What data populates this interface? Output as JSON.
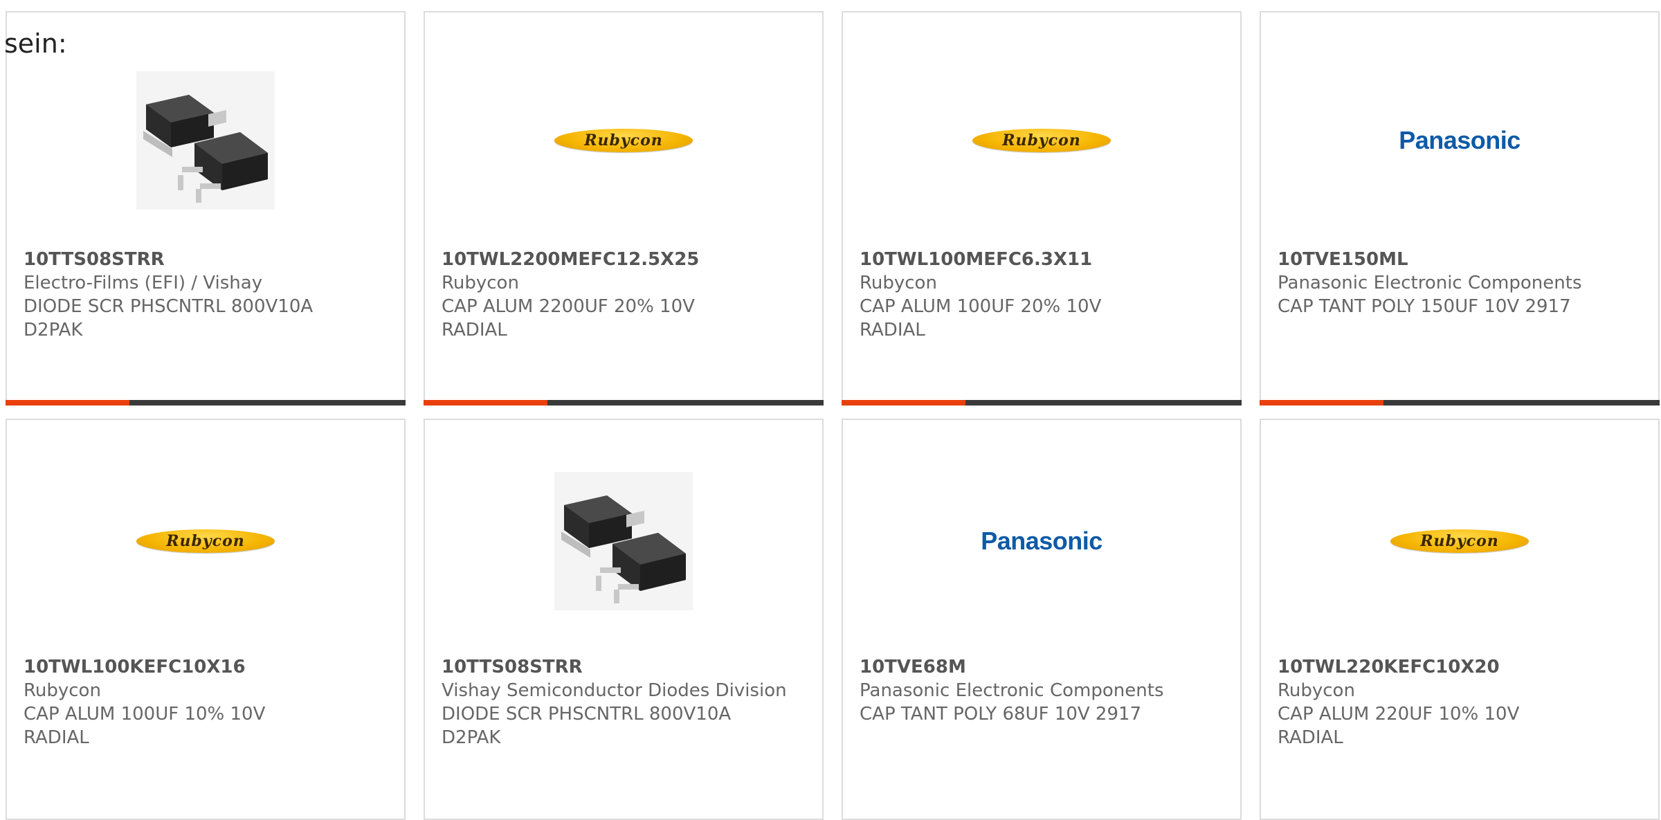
{
  "prefix_text": "sein:",
  "colors": {
    "accent_bar": "#e8400c",
    "dark_bar": "#3a3a3a",
    "rubycon_yellow": "#f5b400",
    "panasonic_blue": "#0e5aa7"
  },
  "logos": {
    "rubycon": "Rubycon",
    "panasonic": "Panasonic"
  },
  "cards": [
    {
      "part_number": "10TTS08STRR",
      "manufacturer": "Electro-Films (EFI) / Vishay",
      "description_lines": [
        "DIODE SCR PHSCNTRL 800V10A",
        "D2PAK"
      ],
      "image": "d2pak-package-icon",
      "progress_fraction": 0.31
    },
    {
      "part_number": "10TWL2200MEFC12.5X25",
      "manufacturer": "Rubycon",
      "description_lines": [
        "CAP ALUM 2200UF 20% 10V",
        "RADIAL"
      ],
      "image": "rubycon-logo",
      "progress_fraction": 0.31
    },
    {
      "part_number": "10TWL100MEFC6.3X11",
      "manufacturer": "Rubycon",
      "description_lines": [
        "CAP ALUM 100UF 20% 10V",
        "RADIAL"
      ],
      "image": "rubycon-logo",
      "progress_fraction": 0.31
    },
    {
      "part_number": "10TVE150ML",
      "manufacturer": "Panasonic Electronic Components",
      "description_lines": [
        "CAP TANT POLY 150UF 10V 2917"
      ],
      "image": "panasonic-logo",
      "progress_fraction": 0.31
    },
    {
      "part_number": "10TWL100KEFC10X16",
      "manufacturer": "Rubycon",
      "description_lines": [
        "CAP ALUM 100UF 10% 10V",
        "RADIAL"
      ],
      "image": "rubycon-logo"
    },
    {
      "part_number": "10TTS08STRR",
      "manufacturer": "Vishay Semiconductor Diodes Division",
      "description_lines": [
        "DIODE SCR PHSCNTRL 800V10A",
        "D2PAK"
      ],
      "image": "d2pak-package-icon"
    },
    {
      "part_number": "10TVE68M",
      "manufacturer": "Panasonic Electronic Components",
      "description_lines": [
        "CAP TANT POLY 68UF 10V 2917"
      ],
      "image": "panasonic-logo"
    },
    {
      "part_number": "10TWL220KEFC10X20",
      "manufacturer": "Rubycon",
      "description_lines": [
        "CAP ALUM 220UF 10% 10V",
        "RADIAL"
      ],
      "image": "rubycon-logo"
    }
  ]
}
